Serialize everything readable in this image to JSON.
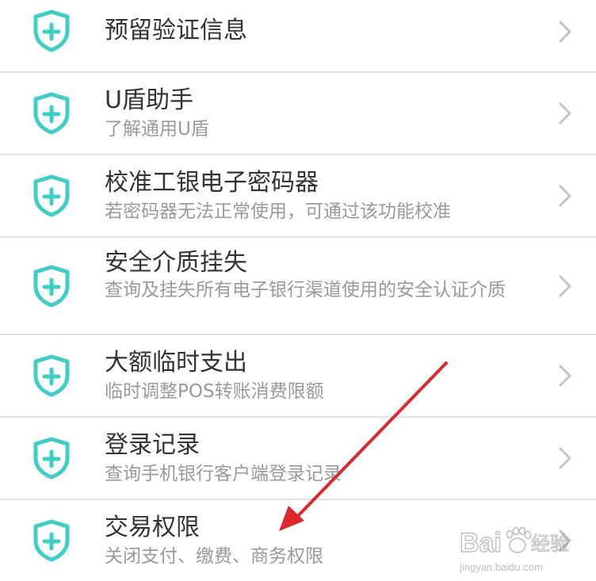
{
  "colors": {
    "shield": "#3ccfc6",
    "title": "#333333",
    "subtitle": "#9a9a9a",
    "chevron": "#c4c4c4",
    "divider": "#e3e3e3",
    "annotation_arrow": "#e0262c"
  },
  "icons": {
    "item_icon": "shield-plus-icon",
    "item_trailing": "chevron-right-icon"
  },
  "menu": {
    "items": [
      {
        "title": "预留验证信息",
        "subtitle": ""
      },
      {
        "title": "U盾助手",
        "subtitle": "了解通用U盾"
      },
      {
        "title": "校准工银电子密码器",
        "subtitle": "若密码器无法正常使用，可通过该功能校准"
      },
      {
        "title": "安全介质挂失",
        "subtitle": "查询及挂失所有电子银行渠道使用的安全认证介质"
      },
      {
        "title": "大额临时支出",
        "subtitle": "临时调整POS转账消费限额"
      },
      {
        "title": "登录记录",
        "subtitle": "查询手机银行客户端登录记录"
      },
      {
        "title": "交易权限",
        "subtitle": "关闭支付、缴费、商务权限"
      }
    ]
  },
  "watermark": {
    "brand": "Bai du 经验",
    "url": "jingyan.baidu.com"
  }
}
